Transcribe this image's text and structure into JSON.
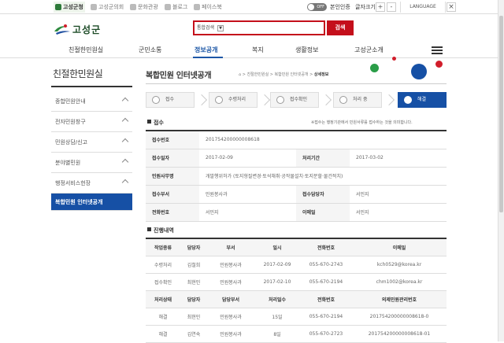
{
  "topbar": {
    "sites": [
      {
        "label": "고성군청",
        "icon": "county-office-icon"
      },
      {
        "label": "고성군의회",
        "icon": "council-icon"
      },
      {
        "label": "문화관광",
        "icon": "tour-icon"
      },
      {
        "label": "블로그",
        "icon": "blog-icon"
      },
      {
        "label": "페이스북",
        "icon": "facebook-icon"
      }
    ],
    "toggle_label": "OFF",
    "auth_label": "본인인증",
    "font_size_label": "글자크기",
    "plus": "+",
    "minus": "-",
    "language_label": "LANGUAGE"
  },
  "header": {
    "logo_text": "고성군",
    "search": {
      "select_value": "통합검색",
      "placeholder": "",
      "button_label": "검색"
    }
  },
  "gnb": {
    "items": [
      "친절한민원실",
      "군민소통",
      "정보공개",
      "복지",
      "생활정보",
      "고성군소개"
    ],
    "active_index": 2
  },
  "sidebar": {
    "title": "친절한민원실",
    "items": [
      "종합민원안내",
      "전자민원창구",
      "민원상담/신고",
      "분야별민원",
      "행정서비스헌장",
      "복합민원 인터넷공개"
    ],
    "active_index": 5
  },
  "page": {
    "title": "복합민원 인터넷공개",
    "breadcrumb": [
      "친절한민원실",
      "복합민원 인터넷공개",
      "상세정보"
    ]
  },
  "steps": [
    "접수",
    "수령처리",
    "접수확인",
    "처리 중",
    "해결"
  ],
  "receipt": {
    "section_title": "접수",
    "note": "※접수는 행정기관에서 민원서류를 접수하는 것을 의미합니다.",
    "rows": [
      {
        "label": "접수번호",
        "value": "201754200000008618"
      },
      {
        "label": "접수일자",
        "value": "2017-02-09",
        "label2": "처리기간",
        "value2": "2017-03-02"
      },
      {
        "label": "민원사무명",
        "value": "개발행위허가 (토지형질변경·토석채취·공작물설치·토지분할·물건적치)"
      },
      {
        "label": "접수부서",
        "value": "민원봉사과",
        "label2": "접수담당자",
        "value2": "서민지"
      },
      {
        "label": "전화번호",
        "value": "서민지",
        "label2": "이메일",
        "value2": "서민지"
      }
    ]
  },
  "progress": {
    "section_title": "진행내역",
    "headers1": [
      "작업종류",
      "담당자",
      "부서",
      "일시",
      "전화번호",
      "이메일"
    ],
    "rows1": [
      [
        "수령처리",
        "김철희",
        "민원봉사과",
        "2017-02-09",
        "055-670-2743",
        "kch0529@korea.kr"
      ],
      [
        "접수확인",
        "최현민",
        "민원봉사과",
        "2017-02-10",
        "055-670-2194",
        "chm1002@korea.kr"
      ]
    ],
    "headers2": [
      "처리상태",
      "담당자",
      "담당부서",
      "처리일수",
      "전화번호",
      "의제민원관리번호"
    ],
    "rows2": [
      [
        "해결",
        "최현민",
        "민원봉사과",
        "15일",
        "055-670-2194",
        "201754200000008618-0"
      ],
      [
        "해결",
        "김연숙",
        "민원봉사과",
        "8일",
        "055-670-2723",
        "201754200000008618-01"
      ]
    ]
  }
}
